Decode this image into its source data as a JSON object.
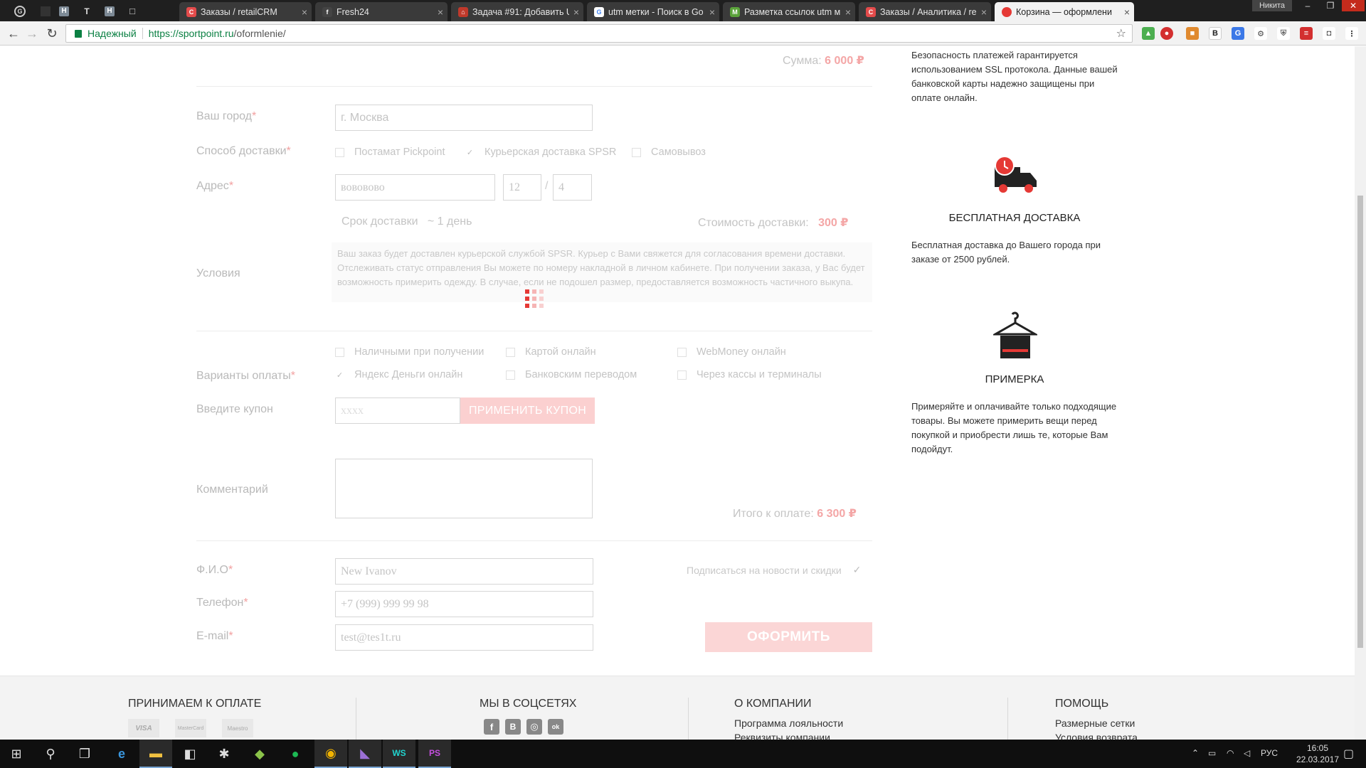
{
  "browser": {
    "pinned_tabs": [
      "G",
      "H",
      "T",
      "H",
      "□"
    ],
    "tabs": [
      {
        "label": "Заказы / retailCRM",
        "icon_color": "#e34b4b",
        "icon_glyph": "C"
      },
      {
        "label": "Fresh24",
        "icon_color": "#444444",
        "icon_glyph": "f"
      },
      {
        "label": "Задача #91: Добавить U",
        "icon_color": "#c0392b",
        "icon_glyph": "⌂"
      },
      {
        "label": "utm метки - Поиск в Go",
        "icon_color": "#4285f4",
        "icon_glyph": "G"
      },
      {
        "label": "Разметка ссылок utm м",
        "icon_color": "#5ba33b",
        "icon_glyph": "M"
      },
      {
        "label": "Заказы / Аналитика / re",
        "icon_color": "#e34b4b",
        "icon_glyph": "C"
      },
      {
        "label": "Корзина — оформлени",
        "icon_color": "#e53935",
        "icon_glyph": "●"
      }
    ],
    "user_name": "Никита",
    "secure_label": "Надежный",
    "url_host": "https://sportpoint.ru",
    "url_path": "/oformlenie/",
    "star_icon": "star-icon"
  },
  "order": {
    "sum_label": "Сумма:",
    "sum_value": "6 000 ₽",
    "city_label": "Ваш город",
    "city_value": "г. Москва",
    "delivery_label": "Способ доставки",
    "delivery_options": [
      {
        "label": "Постамат Pickpoint",
        "checked": false
      },
      {
        "label": "Курьерская доставка SPSR",
        "checked": true
      },
      {
        "label": "Самовывоз",
        "checked": false
      }
    ],
    "address_label": "Адрес",
    "address_street": "вововово",
    "address_house": "12",
    "address_sep": "/",
    "address_flat": "4",
    "term_label": "Срок доставки",
    "term_value": "~ 1 день",
    "cost_label": "Стоимость доставки:",
    "cost_value": "300 ₽",
    "conditions_label": "Условия",
    "conditions_text": "Ваш заказ будет доставлен курьерской службой SPSR. Курьер с Вами свяжется для согласования времени доставки. Отслеживать статус отправления Вы можете по номеру накладной в личном кабинете. При получении заказа, у Вас будет возможность примерить одежду. В случае, если не подошел размер, предоставляется возможность частичного выкупа.",
    "payment_label": "Варианты оплаты",
    "payment_options": [
      {
        "label": "Наличными при получении",
        "checked": false
      },
      {
        "label": "Картой онлайн",
        "checked": false
      },
      {
        "label": "WebMoney онлайн",
        "checked": false
      },
      {
        "label": "Яндекс Деньги онлайн",
        "checked": true
      },
      {
        "label": "Банковским переводом",
        "checked": false
      },
      {
        "label": "Через кассы и терминалы",
        "checked": false
      }
    ],
    "coupon_label": "Введите купон",
    "coupon_placeholder": "xxxx",
    "coupon_button": "ПРИМЕНИТЬ КУПОН",
    "comment_label": "Комментарий",
    "comment_value": "",
    "total_label": "Итого к оплате:",
    "total_value": "6 300 ₽",
    "name_label": "Ф.И.О",
    "name_value": "New Ivanov",
    "phone_label": "Телефон",
    "phone_value": "+7 (999) 999 99 98",
    "email_label": "E-mail",
    "email_value": "test@tes1t.ru",
    "subscribe_label": "Подписаться на новости и скидки",
    "subscribe_checked": true,
    "submit_button": "ОФОРМИТЬ",
    "required_mark": "*"
  },
  "sidebar": {
    "security_text": "Безопасность платежей гарантируется использованием SSL протокола. Данные вашей банковской карты надежно защищены при оплате онлайн.",
    "delivery_title": "БЕСПЛАТНАЯ ДОСТАВКА",
    "delivery_text": "Бесплатная доставка до Вашего города при заказе от 2500 рублей.",
    "fitting_title": "ПРИМЕРКА",
    "fitting_text": "Примеряйте и оплачивайте только подходящие товары. Вы можете примерить вещи перед покупкой и приобрести лишь те, которые Вам подойдут."
  },
  "footer": {
    "payment_title": "ПРИНИМАЕМ К ОПЛАТЕ",
    "payment_logos": [
      "VISA",
      "MasterCard",
      "Maestro"
    ],
    "social_title": "МЫ В СОЦСЕТЯХ",
    "social_icons": [
      "f",
      "B",
      "◎",
      "ok"
    ],
    "company_title": "О КОМПАНИИ",
    "company_links": [
      "Программа лояльности",
      "Реквизиты компании"
    ],
    "help_title": "ПОМОЩЬ",
    "help_links": [
      "Размерные сетки",
      "Условия возврата"
    ]
  },
  "taskbar": {
    "apps": [
      "windows-icon",
      "search-icon",
      "task-view-icon",
      "edge-icon",
      "explorer-icon",
      "store-icon",
      "slack-icon",
      "gitkraken-icon",
      "spotify-icon",
      "chrome-icon",
      "visual-studio-icon",
      "webstorm-icon",
      "phpstorm-icon"
    ],
    "lang": "РУС",
    "time": "16:05",
    "date": "22.03.2017"
  },
  "colors": {
    "accent": "#f4a6a6",
    "button_bg": "#fbd6d6",
    "label_gray": "#b9b9b9"
  }
}
